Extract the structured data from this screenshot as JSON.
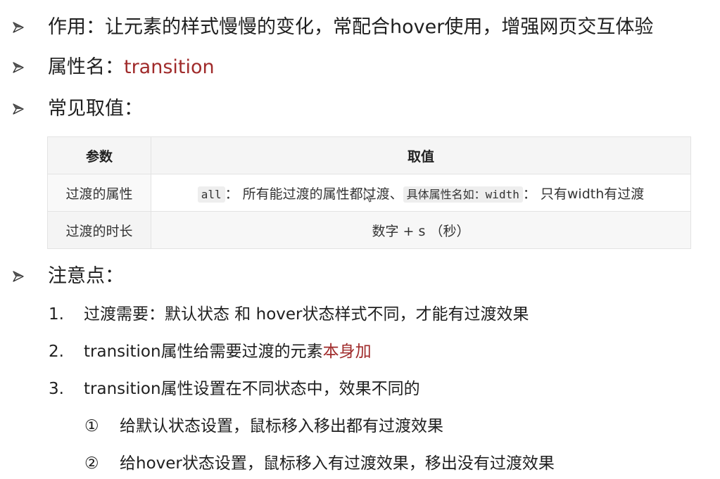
{
  "bullets": {
    "purpose": "作用：让元素的样式慢慢的变化，常配合hover使用，增强网页交互体验",
    "prop_prefix": "属性名：",
    "prop_name": "transition",
    "common_values": "常见取值：",
    "notes": "注意点："
  },
  "table": {
    "header_param": "参数",
    "header_value": "取值",
    "row1_param": "过渡的属性",
    "row1_code_all": "all",
    "row1_text_a": "： 所有能过渡的属性都过渡、",
    "row1_code_specific": "具体属性名如：width",
    "row1_text_b": "： 只有width有过渡",
    "row2_param": "过渡的时长",
    "row2_value": "数字 + s （秒）"
  },
  "notes": {
    "item1_num": "1.",
    "item1": "过渡需要：默认状态 和 hover状态样式不同，才能有过渡效果",
    "item2_num": "2.",
    "item2_prefix": "transition属性给需要过渡的元素",
    "item2_accent": "本身加",
    "item3_num": "3.",
    "item3": "transition属性设置在不同状态中，效果不同的",
    "sub1_mark": "①",
    "sub1": "给默认状态设置，鼠标移入移出都有过渡效果",
    "sub2_mark": "②",
    "sub2": "给hover状态设置，鼠标移入有过渡效果，移出没有过渡效果"
  },
  "colors": {
    "accent": "#a02b2b",
    "text": "#1f1f1f",
    "table_border": "#e3e3e3",
    "header_bg": "#f5f5f5"
  },
  "icons": {
    "bullet": "arrowhead-bullet-icon",
    "cursor": "mouse-pointer-icon"
  }
}
